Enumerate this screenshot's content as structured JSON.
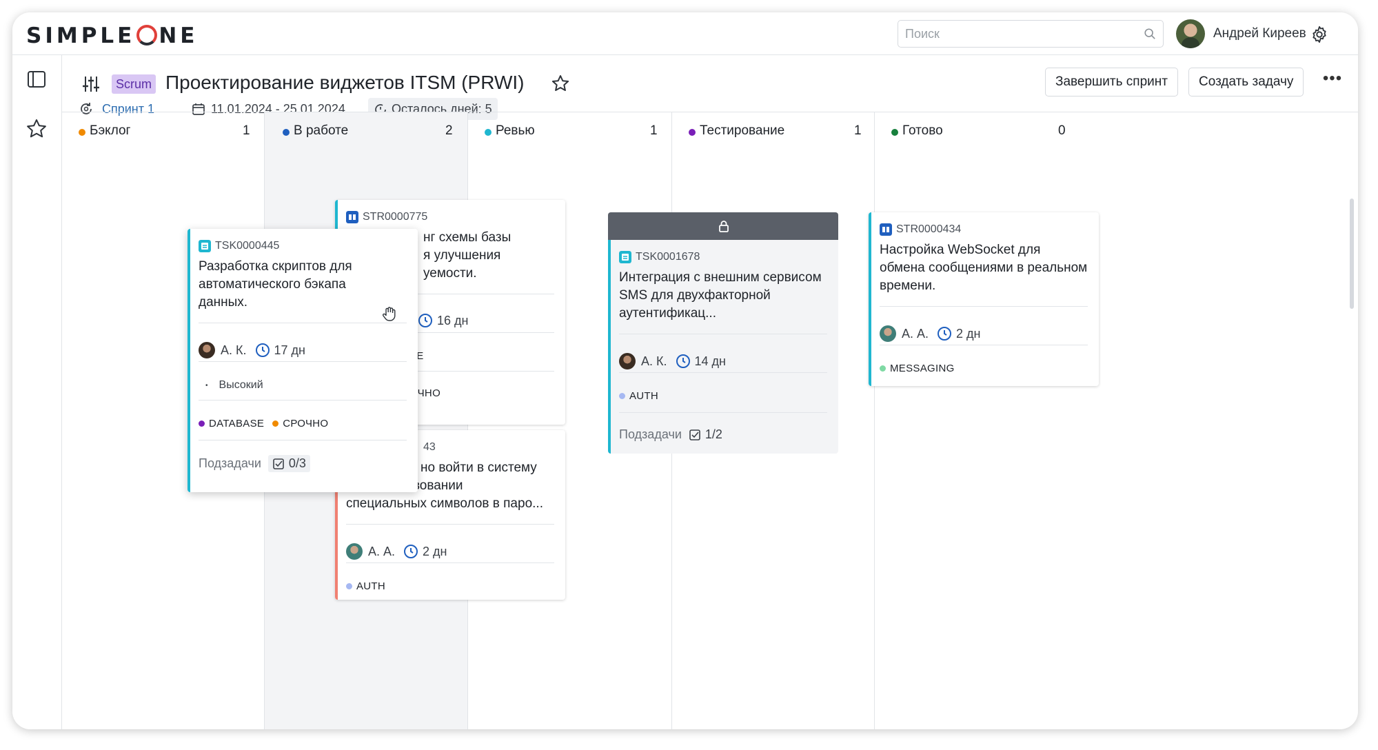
{
  "app": {
    "logo": "SIMPLEONE",
    "search_placeholder": "Поиск",
    "user_name": "Андрей Киреев"
  },
  "header": {
    "badge": "Scrum",
    "title": "Проектирование виджетов ITSM (PRWI)",
    "finish_sprint": "Завершить спринт",
    "create_task": "Создать задачу",
    "sprint": "Спринт 1",
    "dates": "11.01.2024 - 25.01.2024",
    "days_left": "Осталось дней: 5"
  },
  "columns": [
    {
      "name": "Бэклог",
      "count": "1",
      "color": "#f08a00"
    },
    {
      "name": "В работе",
      "count": "2",
      "color": "#1f5fbf"
    },
    {
      "name": "Ревью",
      "count": "1",
      "color": "#1fb7d0"
    },
    {
      "name": "Тестирование",
      "count": "1",
      "color": "#7a1fb8"
    },
    {
      "name": "Готово",
      "count": "0",
      "color": "#17803d"
    }
  ],
  "cards": {
    "dragged": {
      "id": "TSK0000445",
      "title": "Разработка скриптов для автоматического бэкапа данных.",
      "assignee": "А. К.",
      "duration": "17 дн",
      "priority": "Высокий",
      "tags": [
        "DATABASE",
        "СРОЧНО"
      ],
      "subtasks_label": "Подзадачи",
      "subtasks": "0/3"
    },
    "str775": {
      "id": "STR0000775",
      "title_lines": [
        "нг схемы базы",
        "я улучшения",
        "уемости."
      ],
      "duration": "16 дн",
      "tag_fragment": "SE",
      "tag2_fragment": "ОЧНО"
    },
    "second": {
      "id_fragment": "43",
      "title_lines": [
        "но войти в систему",
        "при использовании",
        "специальных символов в паро..."
      ],
      "assignee": "А. А.",
      "duration": "2 дн",
      "tag": "AUTH"
    },
    "review": {
      "id": "TSK0001678",
      "title": "Интеграция с внешним сервисом SMS для двухфакторной аутентификац...",
      "assignee": "А. К.",
      "duration": "14 дн",
      "tag": "AUTH",
      "subtasks_label": "Подзадачи",
      "subtasks": "1/2"
    },
    "testing": {
      "id": "STR0000434",
      "title": "Настройка WebSocket для обмена сообщениями в реальном времени.",
      "assignee": "А. А.",
      "duration": "2 дн",
      "tag": "MESSAGING"
    }
  }
}
